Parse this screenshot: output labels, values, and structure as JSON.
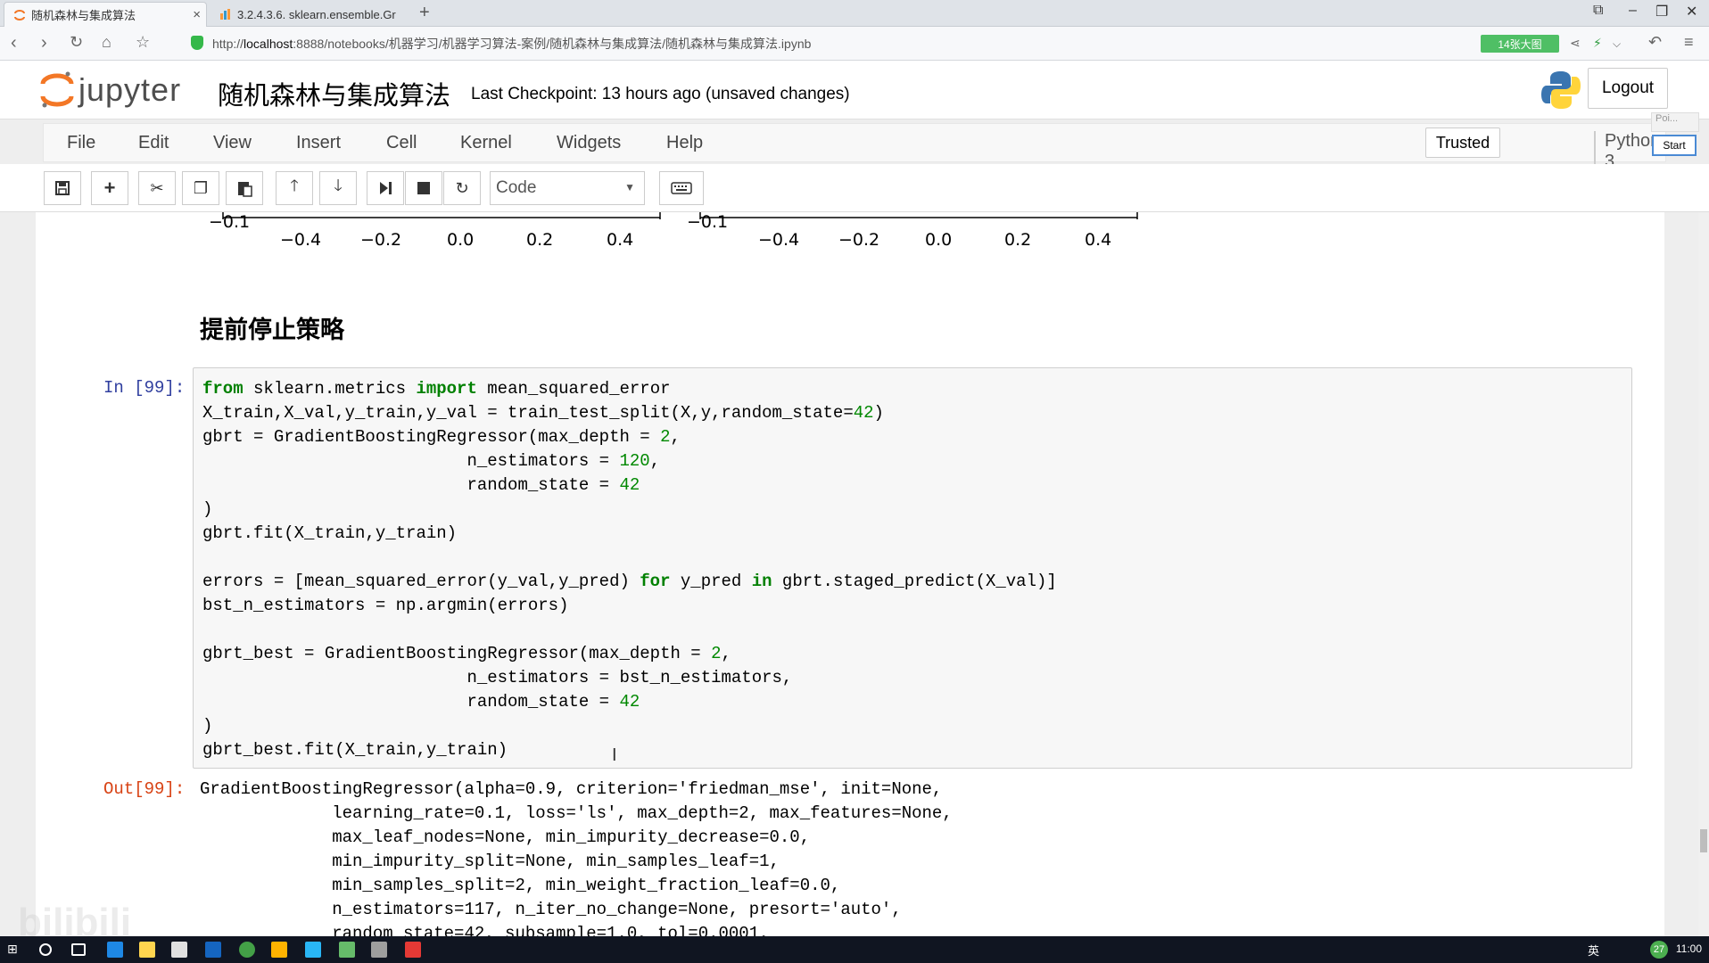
{
  "browser": {
    "tabs": [
      {
        "title": "随机森林与集成算法",
        "active": true
      },
      {
        "title": "3.2.4.3.6. sklearn.ensemble.Gr",
        "active": false
      }
    ],
    "url_prefix": "http://",
    "url_host": "localhost",
    "url_rest": ":8888/notebooks/机器学习/机器学习算法-案例/随机森林与集成算法/随机森林与集成算法.ipynb",
    "badge": "14张大图"
  },
  "jupyter": {
    "logo_text": "jupyter",
    "notebook_name": "随机森林与集成算法",
    "checkpoint": "Last Checkpoint: 13 hours ago (unsaved changes)",
    "logout": "Logout",
    "menu": [
      "File",
      "Edit",
      "View",
      "Insert",
      "Cell",
      "Kernel",
      "Widgets",
      "Help"
    ],
    "trusted": "Trusted",
    "kernel": "Python 3",
    "overlay_poi": "Poi...",
    "overlay_start": "Start",
    "cell_type": "Code"
  },
  "plot_fragment": {
    "left": {
      "ymin_label": "−0.1",
      "ticks": [
        "−0.4",
        "−0.2",
        "0.0",
        "0.2",
        "0.4"
      ]
    },
    "right": {
      "ymin_label": "−0.1",
      "ticks": [
        "−0.4",
        "−0.2",
        "0.0",
        "0.2",
        "0.4"
      ]
    }
  },
  "section_heading": "提前停止策略",
  "cell": {
    "in_prompt": "In [99]:",
    "out_prompt": "Out[99]:",
    "output_lines": [
      "GradientBoostingRegressor(alpha=0.9, criterion='friedman_mse', init=None,",
      "             learning_rate=0.1, loss='ls', max_depth=2, max_features=None,",
      "             max_leaf_nodes=None, min_impurity_decrease=0.0,",
      "             min_impurity_split=None, min_samples_leaf=1,",
      "             min_samples_split=2, min_weight_fraction_leaf=0.0,",
      "             n_estimators=117, n_iter_no_change=None, presort='auto',",
      "             random_state=42, subsample=1.0, tol=0.0001,"
    ]
  },
  "taskbar": {
    "ime": "英",
    "temp": "27",
    "time": "11:00"
  },
  "watermark": "bilibili"
}
